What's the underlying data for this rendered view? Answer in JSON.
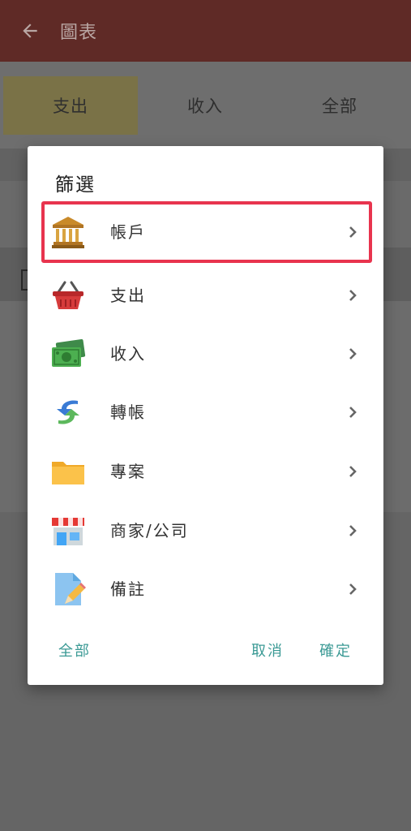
{
  "appbar": {
    "title": "圖表",
    "back_icon": "arrow-left-icon"
  },
  "tabs": [
    {
      "label": "支出",
      "active": true
    },
    {
      "label": "收入",
      "active": false
    },
    {
      "label": "全部",
      "active": false
    }
  ],
  "dialog": {
    "title": "篩選",
    "items": [
      {
        "label": "帳戶",
        "icon": "bank-icon"
      },
      {
        "label": "支出",
        "icon": "basket-icon"
      },
      {
        "label": "收入",
        "icon": "money-icon"
      },
      {
        "label": "轉帳",
        "icon": "transfer-icon"
      },
      {
        "label": "專案",
        "icon": "folder-icon"
      },
      {
        "label": "商家/公司",
        "icon": "store-icon"
      },
      {
        "label": "備註",
        "icon": "note-icon"
      }
    ],
    "buttons": {
      "all": "全部",
      "cancel": "取消",
      "confirm": "確定"
    }
  },
  "colors": {
    "accent": "#3b9a95",
    "highlight": "#e8344e",
    "appbar": "#5f2a26"
  }
}
